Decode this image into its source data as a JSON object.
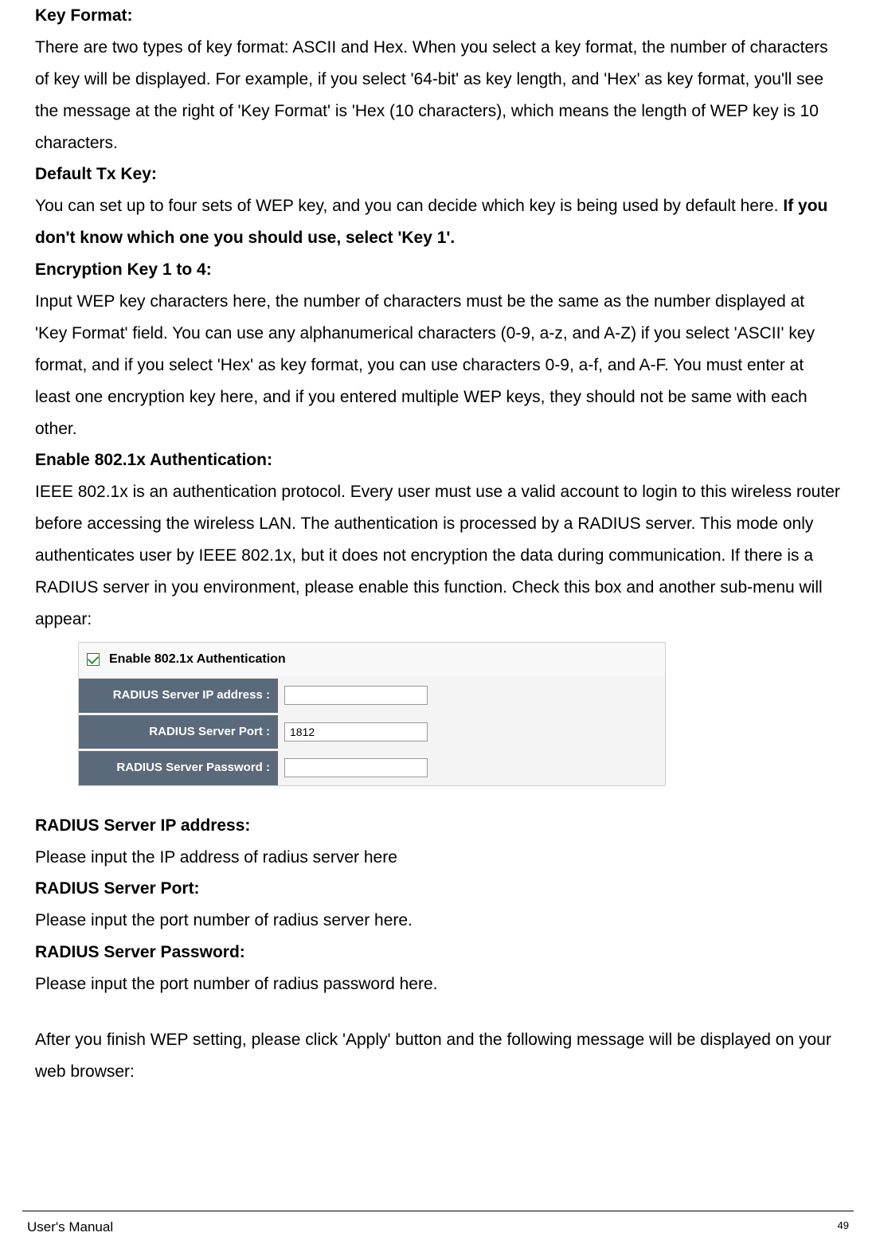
{
  "sections": {
    "key_format": {
      "heading": "Key Format:",
      "text": "There are two types of key format: ASCII and Hex. When you select a key format, the number of characters of key will be displayed. For example, if you select '64-bit' as key length, and 'Hex' as key format, you'll see the message at the right of 'Key Format' is 'Hex (10 characters), which means the length of WEP key is 10 characters."
    },
    "default_tx_key": {
      "heading": "Default Tx Key:",
      "text_before": "You can set up to four sets of WEP key, and you can decide which key is being used by default here. ",
      "text_bold": "If you don't know which one you should use, select 'Key 1'."
    },
    "encryption_key": {
      "heading": "Encryption Key 1 to 4:",
      "text": "Input WEP key characters here, the number of characters must be the same as the number displayed at 'Key Format' field. You can use any alphanumerical characters (0-9, a-z, and A-Z) if you select 'ASCII' key format, and if you select 'Hex' as key format, you can use characters 0-9, a-f, and A-F. You must enter at least one encryption key here, and if you entered multiple WEP keys, they should not be same with each other."
    },
    "enable_8021x": {
      "heading": "Enable 802.1x Authentication:",
      "text": "IEEE 802.1x is an authentication protocol. Every user must use a valid account to login to this wireless router before accessing the wireless LAN. The authentication is processed by a RADIUS server. This mode only authenticates user by IEEE 802.1x, but it does not encryption the data during communication. If there is a RADIUS server in you environment, please enable this function. Check this box and another sub-menu will appear:"
    },
    "radius_ip": {
      "heading": "RADIUS Server IP address:",
      "text": "Please input the IP address of radius server here"
    },
    "radius_port": {
      "heading": "RADIUS Server Port:",
      "text": "Please input the port number of radius server here."
    },
    "radius_password": {
      "heading": "RADIUS Server Password:",
      "text": "Please input the port number of radius password here."
    },
    "closing": "After you finish WEP setting, please click 'Apply' button and the following message will be displayed on your web browser:"
  },
  "form": {
    "checkbox_label": "Enable 802.1x Authentication",
    "rows": {
      "ip": {
        "label": "RADIUS Server IP address :",
        "value": ""
      },
      "port": {
        "label": "RADIUS Server Port :",
        "value": "1812"
      },
      "password": {
        "label": "RADIUS Server Password :",
        "value": ""
      }
    }
  },
  "footer": {
    "title": "User's Manual",
    "page": "49"
  }
}
